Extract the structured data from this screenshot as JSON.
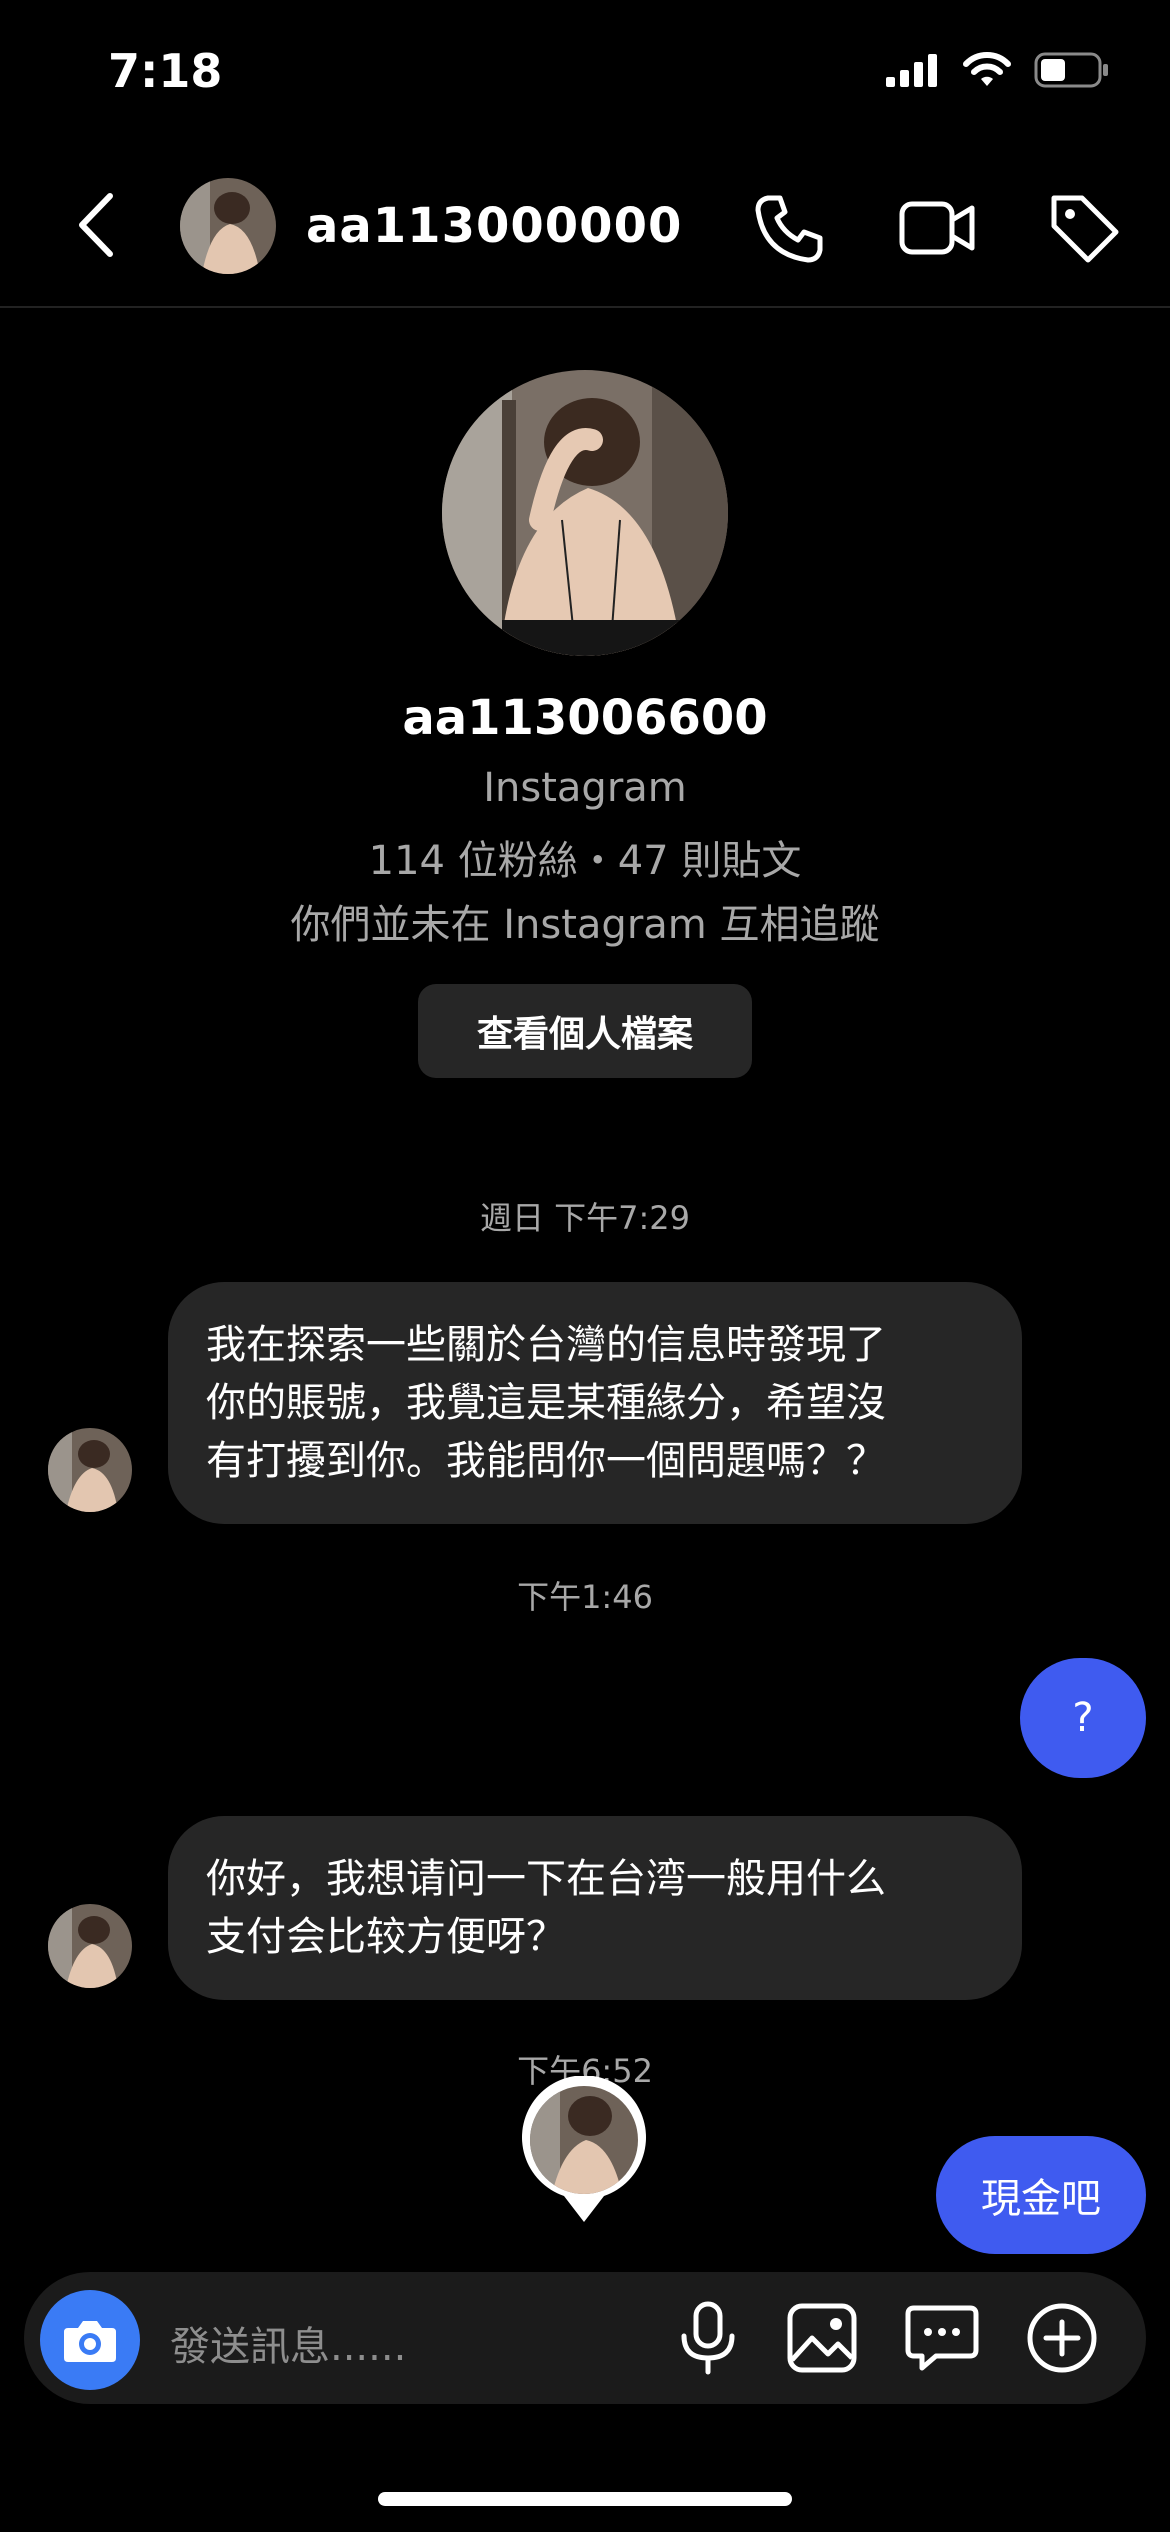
{
  "status_bar": {
    "time": "7:18"
  },
  "header": {
    "username": "aa113000000"
  },
  "profile": {
    "username": "aa113006600",
    "platform": "Instagram",
    "stats": "114 位粉絲・47 則貼文",
    "relation": "你們並未在 Instagram 互相追蹤",
    "view_profile_label": "查看個人檔案"
  },
  "messages": {
    "ts1": "週日 下午7:29",
    "msg1_lines": [
      "我在探索一些關於台灣的信息時發現了",
      "你的賬號，我覺這是某種緣分，希望沒",
      "有打擾到你。我能問你一個問題嗎？？"
    ],
    "ts2": "下午1:46",
    "reply1": "?",
    "msg2_lines": [
      "你好，我想请问一下在台湾一般用什么",
      "支付会比较方便呀？"
    ],
    "ts3": "下午6:52",
    "reply2": "現金吧"
  },
  "composer": {
    "placeholder": "發送訊息......"
  },
  "colors": {
    "accent": "#3f5bf0",
    "camera": "#3a7bf5",
    "bubble_in": "#262626"
  }
}
